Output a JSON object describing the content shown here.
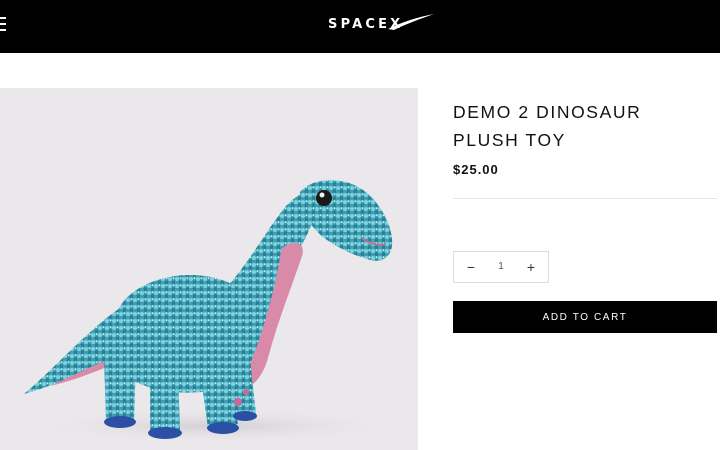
{
  "header": {
    "logo_text": "SPACEX",
    "menu_icon": "hamburger-icon"
  },
  "product": {
    "title": "DEMO 2 DINOSAUR PLUSH TOY",
    "price": "$25.00",
    "image_alt": "dinosaur plush toy image",
    "quantity": {
      "value": "1",
      "minus": "−",
      "plus": "+"
    },
    "add_to_cart_label": "ADD TO CART"
  },
  "colors": {
    "header_bg": "#000000",
    "sequin": "#4ab3c4",
    "belly": "#d98aa8",
    "button_bg": "#000000"
  }
}
